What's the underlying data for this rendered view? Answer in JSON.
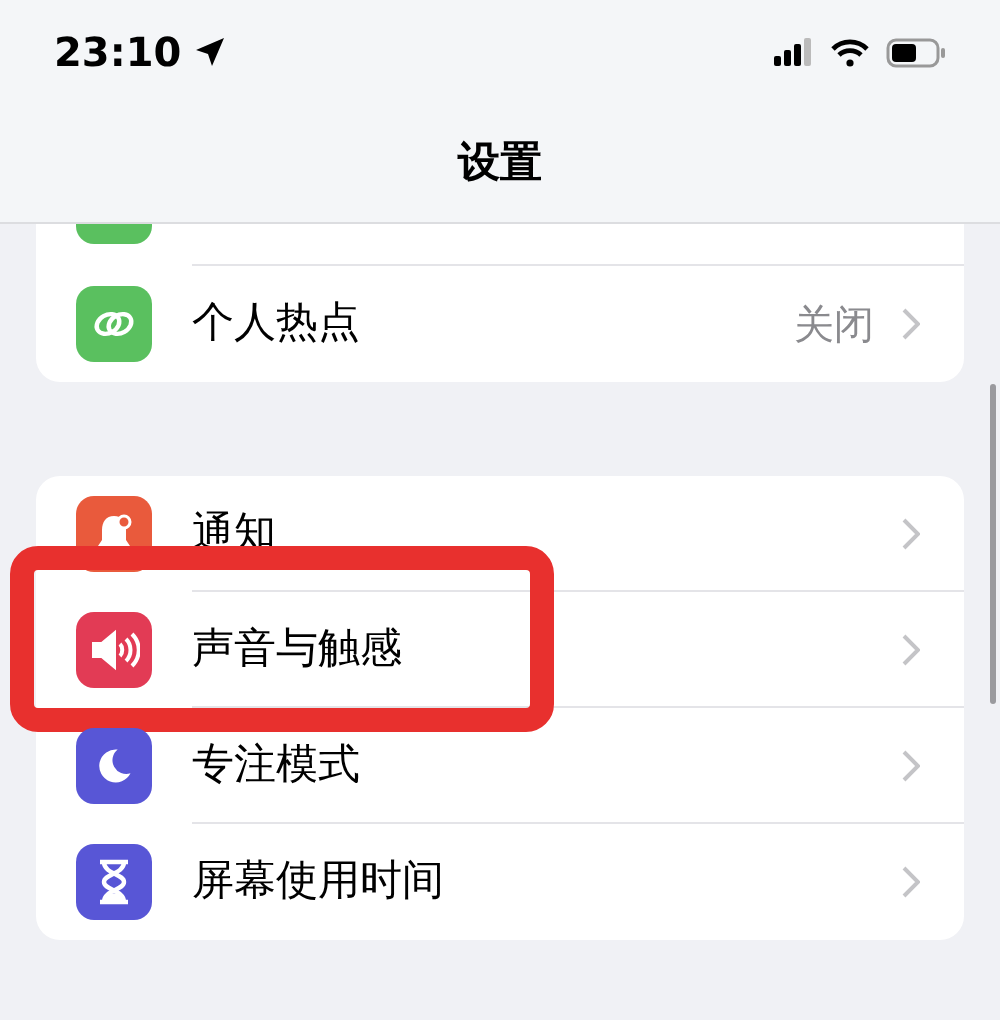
{
  "status_bar": {
    "time": "23:10"
  },
  "title": "设置",
  "groups": [
    {
      "partial_top": true,
      "rows": [
        {
          "kind": "hotspot",
          "label": "个人热点",
          "value": "关闭",
          "annotated": false
        }
      ]
    },
    {
      "partial_top": false,
      "rows": [
        {
          "kind": "notifications",
          "label": "通知",
          "annotated": false
        },
        {
          "kind": "sounds",
          "label": "声音与触感",
          "annotated": true
        },
        {
          "kind": "focus",
          "label": "专注模式",
          "annotated": false
        },
        {
          "kind": "screentime",
          "label": "屏幕使用时间",
          "annotated": false
        }
      ]
    }
  ]
}
